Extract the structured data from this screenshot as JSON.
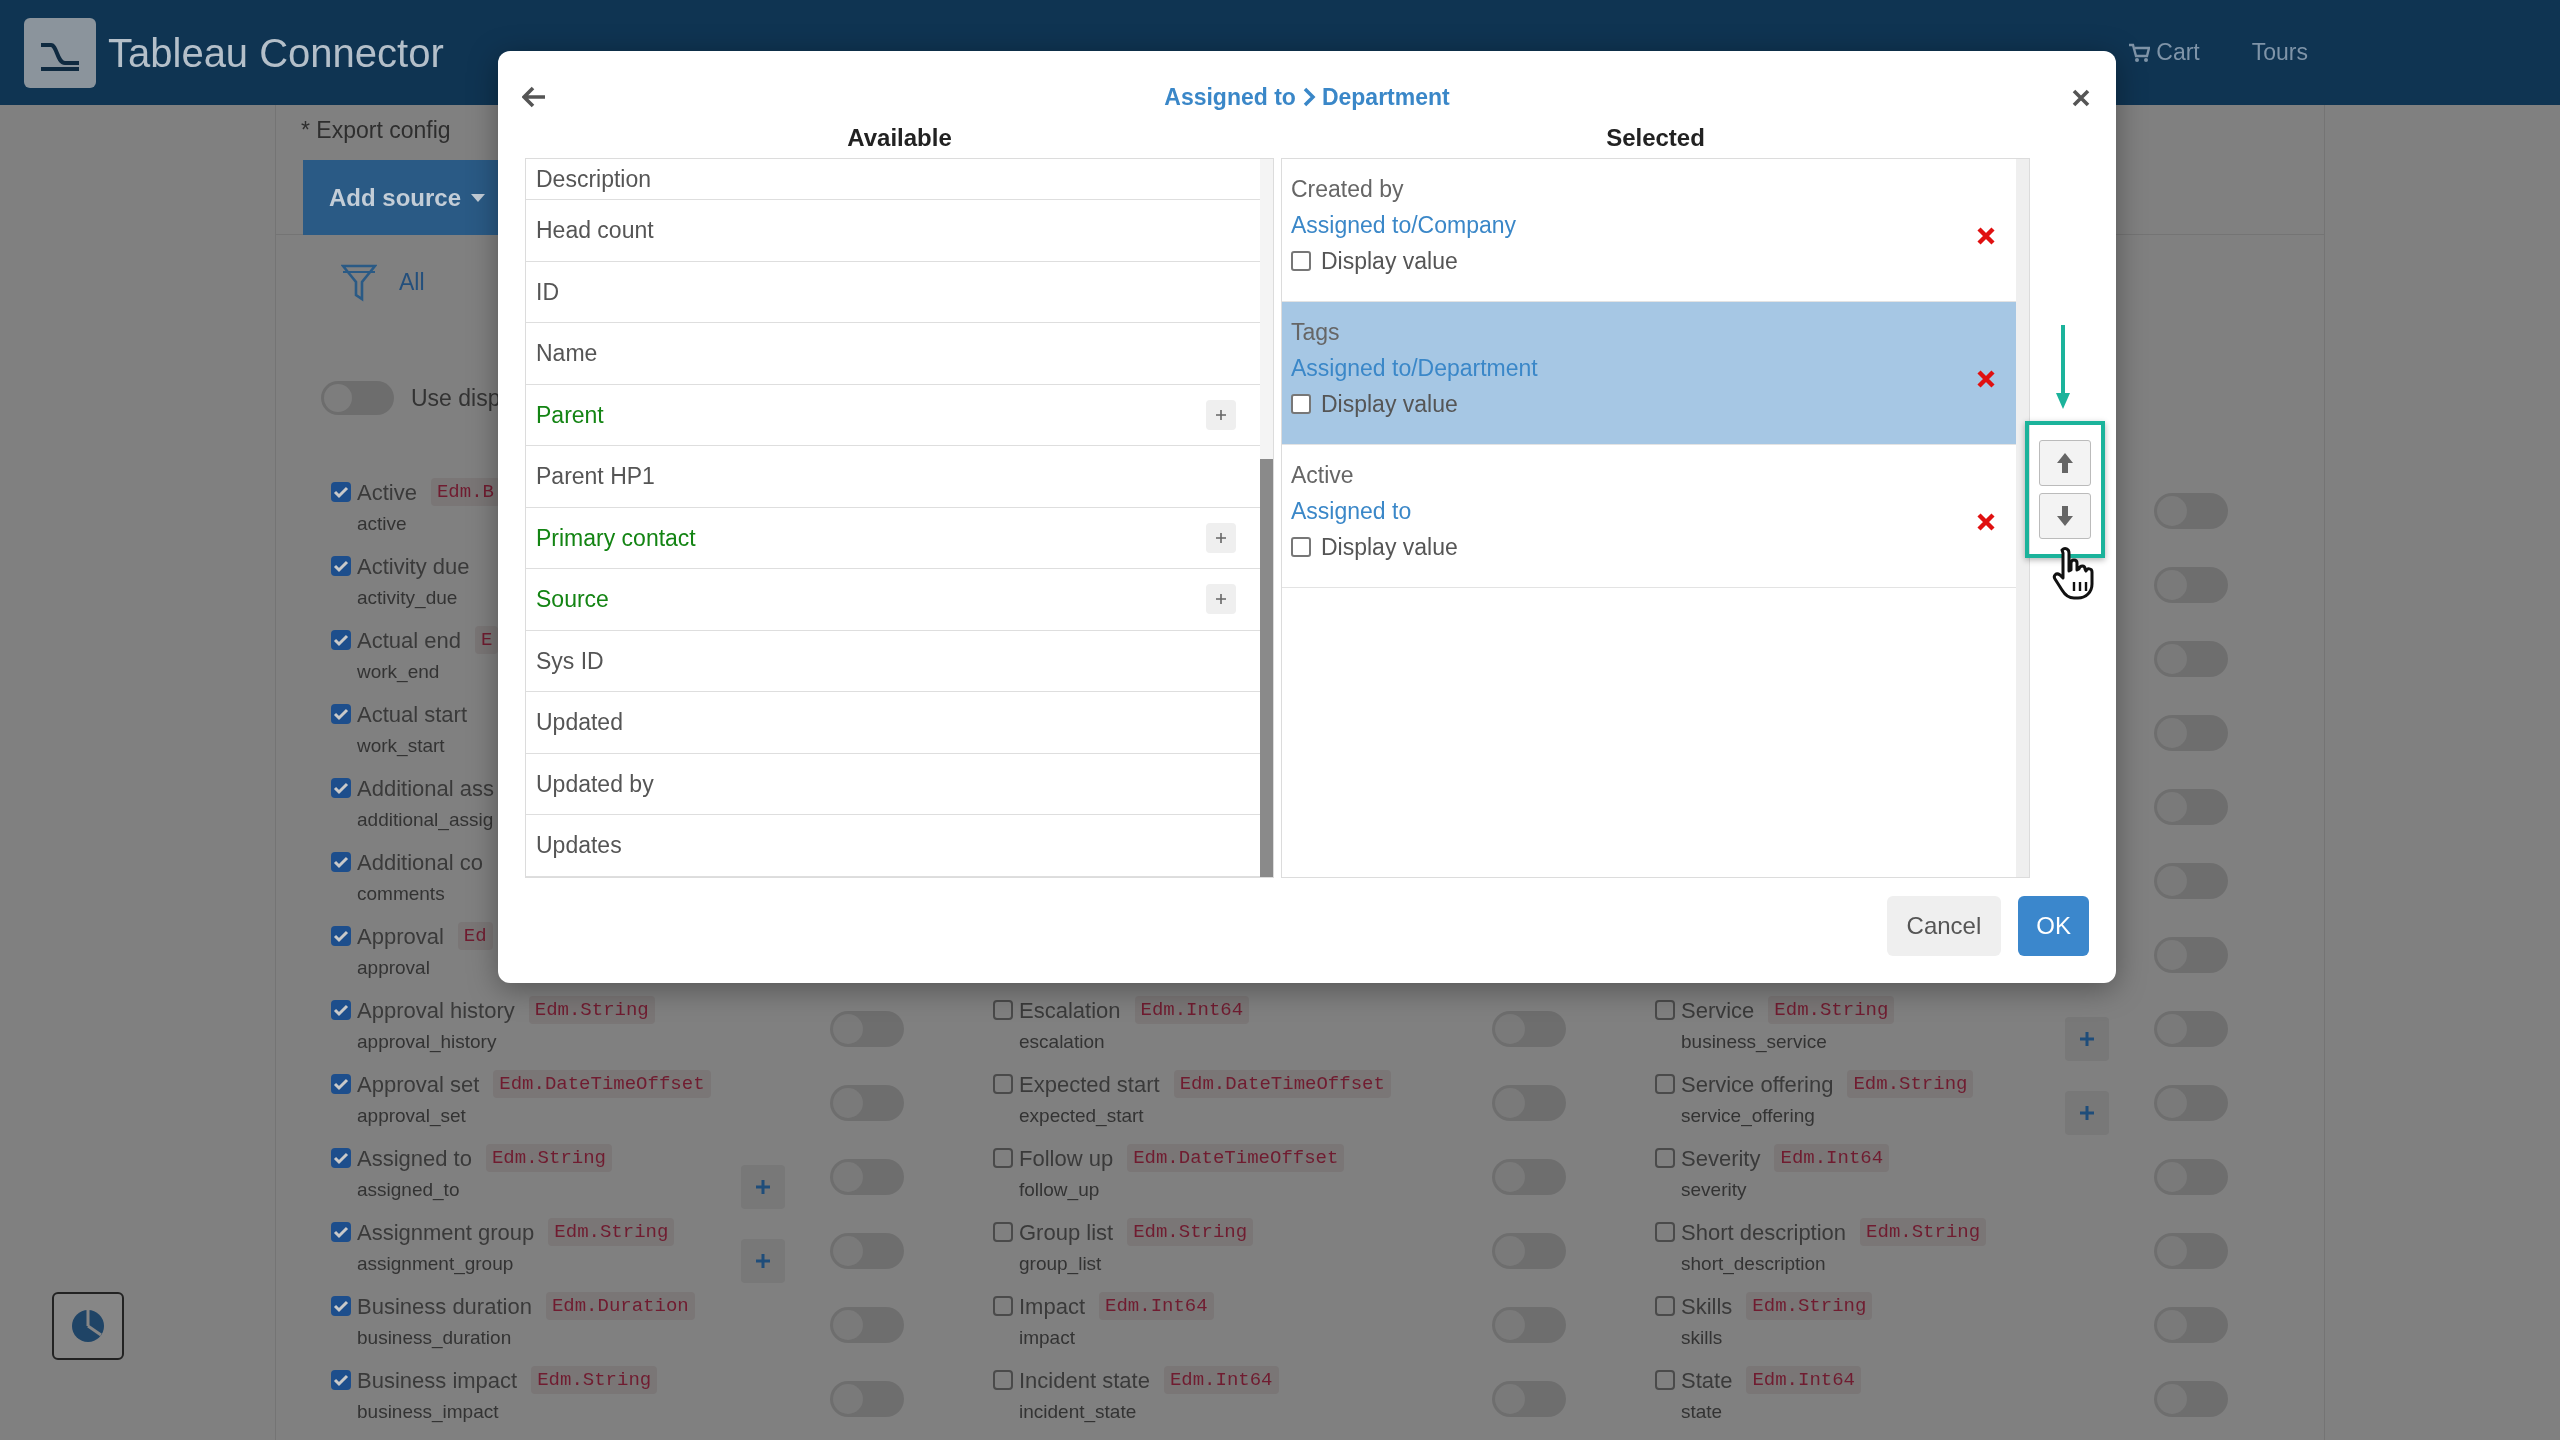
{
  "header": {
    "title": "Tableau Connector",
    "nav": [
      {
        "label": "Cart",
        "kind": "cart"
      },
      {
        "label": "Tours",
        "kind": "link"
      }
    ]
  },
  "page": {
    "export_label": "* Export config",
    "add_source": "Add source",
    "filter_label": "All",
    "display_toggle": {
      "label": "Use disp",
      "on": false
    }
  },
  "field_columns": [
    {
      "rows": [
        {
          "label": "Active",
          "type": "Edm.B",
          "name": "active",
          "checked": true
        },
        {
          "label": "Activity due",
          "name": "activity_due",
          "checked": true
        },
        {
          "label": "Actual end",
          "type": "E",
          "name": "work_end",
          "checked": true
        },
        {
          "label": "Actual start",
          "name": "work_start",
          "checked": true
        },
        {
          "label": "Additional ass",
          "name": "additional_assig",
          "checked": true
        },
        {
          "label": "Additional co",
          "name": "comments",
          "checked": true
        },
        {
          "label": "Approval",
          "type": "Ed",
          "name": "approval",
          "checked": true
        },
        {
          "label": "Approval history",
          "type": "Edm.String",
          "name": "approval_history",
          "checked": true,
          "switch_on": false
        },
        {
          "label": "Approval set",
          "type": "Edm.DateTimeOffset",
          "name": "approval_set",
          "checked": true,
          "switch_on": false
        },
        {
          "label": "Assigned to",
          "type": "Edm.String",
          "name": "assigned_to",
          "checked": true,
          "plus": true,
          "switch_on": false
        },
        {
          "label": "Assignment group",
          "type": "Edm.String",
          "name": "assignment_group",
          "checked": true,
          "plus": true,
          "switch_on": false
        },
        {
          "label": "Business duration",
          "type": "Edm.Duration",
          "name": "business_duration",
          "checked": true,
          "switch_on": false
        },
        {
          "label": "Business impact",
          "type": "Edm.String",
          "name": "business_impact",
          "checked": true,
          "switch_on": false
        }
      ]
    },
    {
      "rows": [
        {
          "label": "Escalation",
          "type": "Edm.Int64",
          "name": "escalation",
          "checked": false,
          "switch_on": false
        },
        {
          "label": "Expected start",
          "type": "Edm.DateTimeOffset",
          "name": "expected_start",
          "checked": false,
          "switch_on": false
        },
        {
          "label": "Follow up",
          "type": "Edm.DateTimeOffset",
          "name": "follow_up",
          "checked": false,
          "switch_on": false
        },
        {
          "label": "Group list",
          "type": "Edm.String",
          "name": "group_list",
          "checked": false,
          "switch_on": false
        },
        {
          "label": "Impact",
          "type": "Edm.Int64",
          "name": "impact",
          "checked": false,
          "switch_on": false
        },
        {
          "label": "Incident state",
          "type": "Edm.Int64",
          "name": "incident_state",
          "checked": false,
          "switch_on": false
        }
      ]
    },
    {
      "rows": [
        {
          "switch_on": false
        },
        {
          "switch_on": false
        },
        {
          "switch_on": false
        },
        {
          "switch_on": false
        },
        {
          "switch_on": false
        },
        {
          "switch_on": false
        },
        {
          "switch_on": false
        },
        {
          "label": "Service",
          "type": "Edm.String",
          "name": "business_service",
          "checked": false,
          "plus": true,
          "switch_on": false
        },
        {
          "label": "Service offering",
          "type": "Edm.String",
          "name": "service_offering",
          "checked": false,
          "plus": true,
          "switch_on": false
        },
        {
          "label": "Severity",
          "type": "Edm.Int64",
          "name": "severity",
          "checked": false,
          "switch_on": false
        },
        {
          "label": "Short description",
          "type": "Edm.String",
          "name": "short_description",
          "checked": false,
          "switch_on": false
        },
        {
          "label": "Skills",
          "type": "Edm.String",
          "name": "skills",
          "checked": false,
          "switch_on": false
        },
        {
          "label": "State",
          "type": "Edm.Int64",
          "name": "state",
          "checked": false,
          "switch_on": false
        }
      ]
    }
  ],
  "dialog": {
    "title_parts": [
      "Assigned to",
      "Department"
    ],
    "available_heading": "Available",
    "selected_heading": "Selected",
    "available": [
      {
        "label": "Description",
        "expandable": false
      },
      {
        "label": "Head count",
        "expandable": false
      },
      {
        "label": "ID",
        "expandable": false
      },
      {
        "label": "Name",
        "expandable": false
      },
      {
        "label": "Parent",
        "expandable": true
      },
      {
        "label": "Parent HP1",
        "expandable": false
      },
      {
        "label": "Primary contact",
        "expandable": true
      },
      {
        "label": "Source",
        "expandable": true
      },
      {
        "label": "Sys ID",
        "expandable": false
      },
      {
        "label": "Updated",
        "expandable": false
      },
      {
        "label": "Updated by",
        "expandable": false
      },
      {
        "label": "Updates",
        "expandable": false
      }
    ],
    "selected": [
      {
        "title": "Created by",
        "path": "Assigned to/Company",
        "checkbox_label": "Display value",
        "display_value": false,
        "selected": false
      },
      {
        "title": "Tags",
        "path": "Assigned to/Department",
        "checkbox_label": "Display value",
        "display_value": false,
        "selected": true
      },
      {
        "title": "Active",
        "path": "Assigned to",
        "checkbox_label": "Display value",
        "display_value": false,
        "selected": false
      }
    ],
    "buttons": [
      {
        "label": "Cancel",
        "kind": "secondary"
      },
      {
        "label": "OK",
        "kind": "primary"
      }
    ]
  }
}
